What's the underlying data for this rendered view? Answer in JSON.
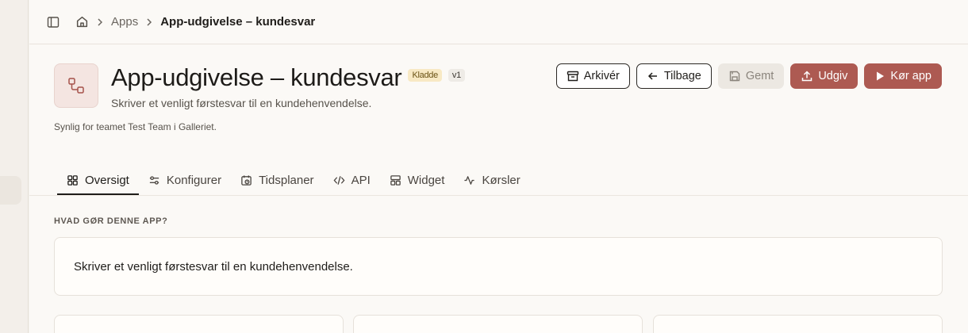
{
  "breadcrumb": {
    "apps_label": "Apps",
    "current_label": "App-udgivelse – kundesvar"
  },
  "header": {
    "title": "App-udgivelse – kundesvar",
    "status_badge": "Kladde",
    "version_badge": "v1",
    "subtitle": "Skriver et venligt førstesvar til en kundehenvendelse.",
    "visibility_note": "Synlig for teamet Test Team i Galleriet."
  },
  "actions": {
    "archive_label": "Arkivér",
    "back_label": "Tilbage",
    "saved_label": "Gemt",
    "publish_label": "Udgiv",
    "run_label": "Kør app"
  },
  "tabs": [
    {
      "label": "Oversigt",
      "icon": "grid-icon"
    },
    {
      "label": "Konfigurer",
      "icon": "sliders-icon"
    },
    {
      "label": "Tidsplaner",
      "icon": "calendar-clock-icon"
    },
    {
      "label": "API",
      "icon": "code-icon"
    },
    {
      "label": "Widget",
      "icon": "layout-icon"
    },
    {
      "label": "Kørsler",
      "icon": "activity-icon"
    }
  ],
  "overview": {
    "section_label": "HVAD GØR DENNE APP?",
    "description": "Skriver et venligt førstesvar til en kundehenvendelse."
  },
  "colors": {
    "accent": "#ad5a52",
    "draft_badge_bg": "#f8e9c4",
    "background": "#fbf9f6"
  }
}
